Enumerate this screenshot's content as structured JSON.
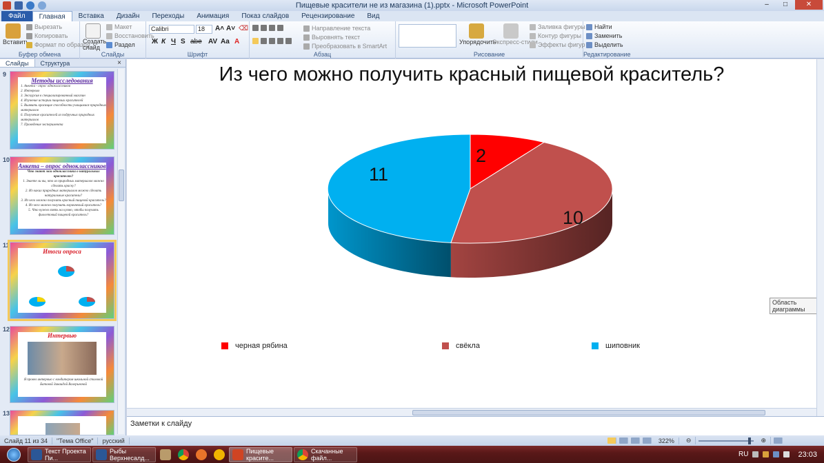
{
  "window": {
    "title": "Пищевые красители не из магазина (1).pptx - Microsoft PowerPoint",
    "minimize": "–",
    "maximize": "□",
    "close": "✕"
  },
  "tabs": [
    "Файл",
    "Главная",
    "Вставка",
    "Дизайн",
    "Переходы",
    "Анимация",
    "Показ слайдов",
    "Рецензирование",
    "Вид"
  ],
  "ribbon": {
    "clipboard": {
      "paste": "Вставить",
      "cut": "Вырезать",
      "copy": "Копировать",
      "format": "Формат по образцу",
      "label": "Буфер обмена"
    },
    "slides": {
      "new_slide": "Создать слайд",
      "layout": "Макет",
      "reset": "Восстановить",
      "section": "Раздел",
      "label": "Слайды"
    },
    "font": {
      "name": "Calibri",
      "size": "18",
      "bold": "Ж",
      "italic": "К",
      "underline": "Ч",
      "strike": "S",
      "shadow": "abe",
      "label": "Шрифт"
    },
    "paragraph": {
      "direction": "Направление текста",
      "align_text": "Выровнять текст",
      "smartart": "Преобразовать в SmartArt",
      "label": "Абзац"
    },
    "drawing": {
      "arrange": "Упорядочить",
      "quick_styles": "Экспресс-стили",
      "fill": "Заливка фигуры",
      "outline": "Контур фигуры",
      "effects": "Эффекты фигур",
      "label": "Рисование"
    },
    "editing": {
      "find": "Найти",
      "replace": "Заменить",
      "select": "Выделить",
      "label": "Редактирование"
    }
  },
  "sidepanel": {
    "tab_slides": "Слайды",
    "tab_outline": "Структура",
    "close": "×",
    "thumbs": [
      {
        "num": "9",
        "title": "Методы исследования",
        "lines": [
          "1. Анкета - опрос одноклассников",
          "2. Интервью",
          "3. Экскурсия в специализированный магазин",
          "4. Изучение истории пищевых красителей",
          "5. Выявить красящие способности учащимися природных материалов",
          "6. Получение красителей из подручных природных материалов",
          "7. Проведение эксперимента"
        ]
      },
      {
        "num": "10",
        "title": "Анкета – опрос одноклассников",
        "lines": [
          "Что знают мои одноклассники о натуральных красителях?",
          "1. Знаете ли вы, что из природных материалов можно сделать краску?",
          "2. Из каких природных материалов можно сделать натуральные красители?",
          "3. Из чего можно получить красный пищевой краситель?",
          "4. Из чего можно получить коричневый краситель?",
          "5. Что нужно взять на кухню, чтобы получить фиолетовый пищевой краситель?"
        ]
      },
      {
        "num": "11",
        "title": "Итоги опроса"
      },
      {
        "num": "12",
        "title": "Интервью",
        "caption": "Я провел интервью с кондитером школьной столовой Батовой Зинаидой Валерьевной"
      },
      {
        "num": "13"
      }
    ]
  },
  "slide": {
    "title": "Из чего можно получить красный пищевой краситель?",
    "tooltip": "Область диаграммы"
  },
  "chart_data": {
    "type": "pie",
    "title": "Из чего можно получить красный пищевой краситель?",
    "categories": [
      "черная рябина",
      "свёкла",
      "шиповник"
    ],
    "values": [
      2,
      10,
      11
    ],
    "colors": [
      "#ff0000",
      "#c0504d",
      "#00b0f0"
    ],
    "legend_position": "bottom",
    "three_d": true
  },
  "notes": {
    "placeholder": "Заметки к слайду"
  },
  "status": {
    "slide_info": "Слайд 11 из 34",
    "theme": "\"Тема Office\"",
    "language": "русский",
    "zoom": "322%"
  },
  "taskbar": {
    "tasks": [
      "Текст Проекта Пи...",
      "Рыбы Верхнесалд...",
      "Пищевые красите...",
      "Скачанные файл..."
    ],
    "lang": "RU",
    "time": "23:03"
  }
}
